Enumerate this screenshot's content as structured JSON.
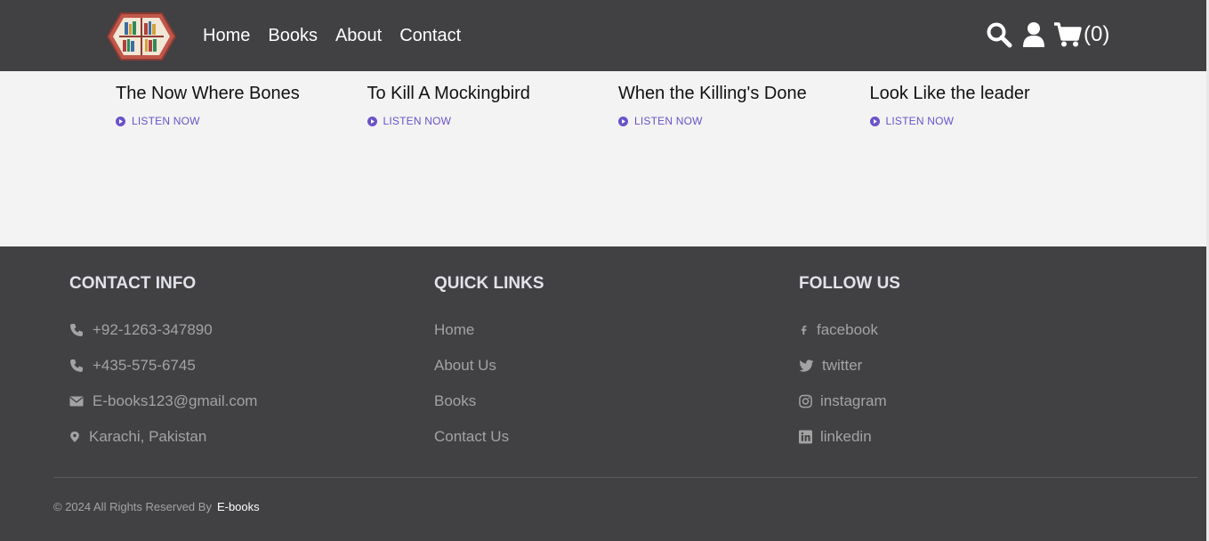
{
  "header": {
    "nav": [
      "Home",
      "Books",
      "About",
      "Contact"
    ],
    "cart_count": "(0)"
  },
  "books": [
    {
      "title": "The Now Where Bones",
      "action": "LISTEN NOW"
    },
    {
      "title": "To Kill A Mockingbird",
      "action": "LISTEN NOW"
    },
    {
      "title": "When the Killing's Done",
      "action": "LISTEN NOW"
    },
    {
      "title": "Look Like the leader",
      "action": "LISTEN NOW"
    }
  ],
  "footer": {
    "contact": {
      "title": "CONTACT INFO",
      "items": [
        "+92-1263-347890",
        "+435-575-6745",
        "E-books123@gmail.com",
        "Karachi, Pakistan"
      ]
    },
    "links": {
      "title": "QUICK LINKS",
      "items": [
        "Home",
        "About Us",
        "Books",
        "Contact Us"
      ]
    },
    "follow": {
      "title": "FOLLOW US",
      "items": [
        "facebook",
        "twitter",
        "instagram",
        "linkedin"
      ]
    },
    "copyright": "© 2024 All Rights Reserved By",
    "brand": "E-books"
  },
  "colors": {
    "header_bg": "#414043",
    "accent": "#6a52c9",
    "logo": "#c0574a"
  },
  "icons": [
    "logo-icon",
    "search-icon",
    "user-icon",
    "cart-icon",
    "play-circle-icon",
    "phone-icon",
    "envelope-icon",
    "map-pin-icon",
    "facebook-icon",
    "twitter-icon",
    "instagram-icon",
    "linkedin-icon"
  ]
}
